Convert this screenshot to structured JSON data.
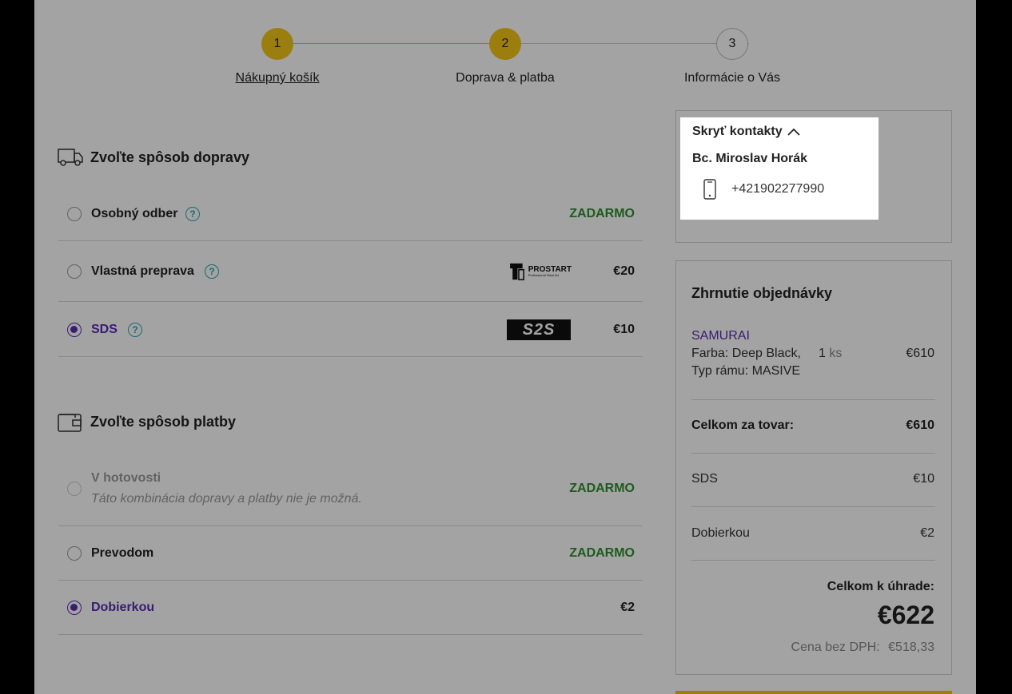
{
  "stepper": {
    "steps": [
      {
        "number": "1",
        "label": "Nákupný košík"
      },
      {
        "number": "2",
        "label": "Doprava & platba"
      },
      {
        "number": "3",
        "label": "Informácie o Vás"
      }
    ],
    "active_color": "#f5c518"
  },
  "shipping": {
    "title": "Zvoľte spôsob dopravy",
    "options": [
      {
        "label": "Osobný odber",
        "price": "ZADARMO"
      },
      {
        "label": "Vlastná preprava",
        "price": "€20",
        "logo_text": "PROSTART",
        "logo_sub": "Professional Steel Art"
      },
      {
        "label": "SDS",
        "price": "€10",
        "logo_text": "S2S"
      }
    ]
  },
  "payment": {
    "title": "Zvoľte spôsob platby",
    "options": [
      {
        "label": "V hotovosti",
        "note": "Táto kombinácia dopravy a platby nie je možná.",
        "price": "ZADARMO"
      },
      {
        "label": "Prevodom",
        "price": "ZADARMO"
      },
      {
        "label": "Dobierkou",
        "price": "€2"
      }
    ]
  },
  "contacts": {
    "toggle": "Skryť kontakty",
    "name": "Bc. Miroslav Horák",
    "phone": "+421902277990"
  },
  "summary": {
    "title": "Zhrnutie objednávky",
    "product": {
      "name": "SAMURAI",
      "attr1": "Farba: Deep Black,",
      "attr2": "Typ rámu: MASIVE",
      "qty": "1",
      "unit": "ks",
      "price": "€610"
    },
    "goods_total_label": "Celkom za tovar:",
    "goods_total": "€610",
    "shipping_label": "SDS",
    "shipping_price": "€10",
    "payment_label": "Dobierkou",
    "payment_price": "€2",
    "total_label": "Celkom k úhrade:",
    "total": "€622",
    "net_label": "Cena bez DPH:",
    "net": "€518,33"
  },
  "colors": {
    "accent_purple": "#5b2bb5",
    "free_green": "#2f8f2f",
    "help_teal": "#2aa6b8"
  }
}
